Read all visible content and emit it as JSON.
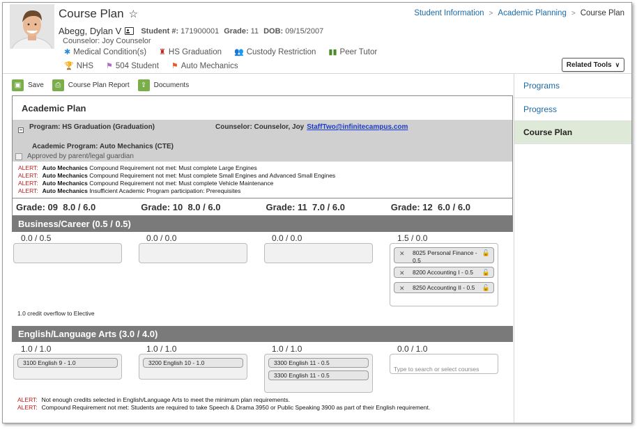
{
  "header": {
    "title": "Course Plan",
    "student_name": "Abegg, Dylan V",
    "student_num_label": "Student #:",
    "student_num": "171900001",
    "grade_label": "Grade:",
    "grade": "11",
    "dob_label": "DOB:",
    "dob": "09/15/2007",
    "counselor": "Counselor: Joy Counselor",
    "flags_row1": [
      "Medical Condition(s)",
      "HS Graduation",
      "Custody Restriction",
      "Peer Tutor"
    ],
    "flags_row2": [
      "NHS",
      "504 Student",
      "Auto Mechanics"
    ],
    "related_tools": "Related Tools"
  },
  "breadcrumb": [
    "Student Information",
    "Academic Planning",
    "Course Plan"
  ],
  "toolbar": {
    "save": "Save",
    "report": "Course Plan Report",
    "documents": "Documents"
  },
  "sidebar": [
    "Programs",
    "Progress",
    "Course Plan"
  ],
  "colors": {
    "accent": "#7aae4a",
    "link": "#1a6aa8",
    "alert": "#c01a1a",
    "category_bar": "#7a7a7a",
    "active_side": "#dfe9d8"
  },
  "plan": {
    "title": "Academic Plan",
    "program": "Program: HS Graduation (Graduation)",
    "counselor": "Counselor: Counselor, Joy",
    "email": "StaffTwo@infinitecampus.com",
    "academic_program": "Academic Program: Auto Mechanics (CTE)",
    "approved": "Approved by parent/legal guardian",
    "alerts": [
      {
        "label": "ALERT:",
        "bold": "Auto Mechanics",
        "text": "Compound Requirement not met: Must complete Large Engines"
      },
      {
        "label": "ALERT:",
        "bold": "Auto Mechanics",
        "text": "Compound Requirement not met: Must complete Small Engines and Advanced Small Engines"
      },
      {
        "label": "ALERT:",
        "bold": "Auto Mechanics",
        "text": "Compound Requirement not met: Must complete Vehicle Maintenance"
      },
      {
        "label": "ALERT:",
        "bold": "Auto Mechanics",
        "text": "Insufficient Academic Program participation: Prerequisites"
      }
    ],
    "grades": [
      {
        "label": "Grade: 09",
        "credits": "8.0 / 6.0"
      },
      {
        "label": "Grade: 10",
        "credits": "8.0 / 6.0"
      },
      {
        "label": "Grade: 11",
        "credits": "7.0 / 6.0"
      },
      {
        "label": "Grade: 12",
        "credits": "6.0 / 6.0"
      }
    ]
  },
  "business": {
    "title": "Business/Career (0.5 / 0.5)",
    "credits": [
      "0.0 / 0.5",
      "0.0 / 0.0",
      "0.0 / 0.0",
      "1.5 / 0.0"
    ],
    "courses": [
      "8025 Personal Finance - 0.5",
      "8200 Accounting I - 0.5",
      "8250 Accounting II - 0.5"
    ],
    "note": "1.0 credit overflow to Elective"
  },
  "english": {
    "title": "English/Language Arts (3.0 / 4.0)",
    "credits": [
      "1.0 / 1.0",
      "1.0 / 1.0",
      "1.0 / 1.0",
      "0.0 / 1.0"
    ],
    "g9": "3100 English 9 - 1.0",
    "g10": "3200 English 10 - 1.0",
    "g11": [
      "3300 English 11 - 0.5",
      "3300 English 11 - 0.5"
    ],
    "search_placeholder": "Type to search or select courses",
    "alerts": [
      {
        "label": "ALERT:",
        "text": "Not enough credits selected in English/Language Arts to meet the minimum plan requirements."
      },
      {
        "label": "ALERT:",
        "text": "Compound Requirement not met: Students are required to take Speech & Drama 3950 or Public Speaking 3900 as part of their English requirement."
      }
    ]
  }
}
